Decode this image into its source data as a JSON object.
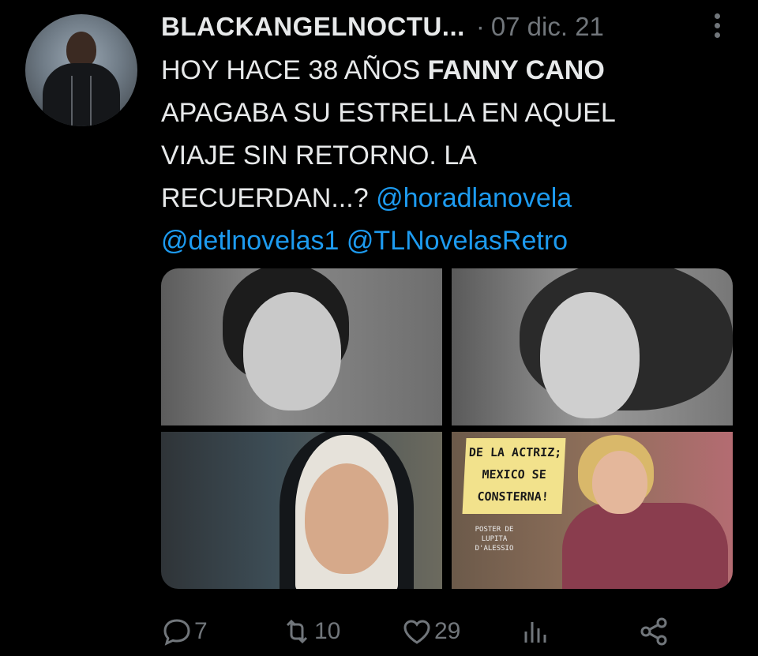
{
  "tweet": {
    "username": "BLACKANGELNOCTU...",
    "separator": "·",
    "date": "07 dic. 21",
    "text": {
      "line1_pre": "HOY HACE 38 AÑOS ",
      "line1_bold": "FANNY CANO",
      "line2": "APAGABA SU ESTRELLA EN AQUEL",
      "line3": "VIAJE SIN RETORNO. LA",
      "line4_pre": "RECUERDAN...? ",
      "mention1": "@horadlanovela",
      "mention2": "@detlnovelas1",
      "mention3": "@TLNovelasRetro"
    },
    "media": {
      "image4": {
        "sign_line1": "DE LA ACTRIZ;",
        "sign_line2": "MEXICO SE",
        "sign_line3": "CONSTERNA!",
        "caption_line1": "POSTER DE",
        "caption_line2": "LUPITA D'ALESSIO"
      }
    },
    "actions": {
      "replies": "7",
      "retweets": "10",
      "likes": "29"
    }
  },
  "icons": {
    "more": "more-vertical-icon",
    "reply": "reply-icon",
    "retweet": "retweet-icon",
    "like": "heart-icon",
    "views": "views-chart-icon",
    "share": "share-icon"
  },
  "colors": {
    "background": "#000000",
    "text": "#e7e9ea",
    "muted": "#71767b",
    "link": "#1d9bf0"
  }
}
